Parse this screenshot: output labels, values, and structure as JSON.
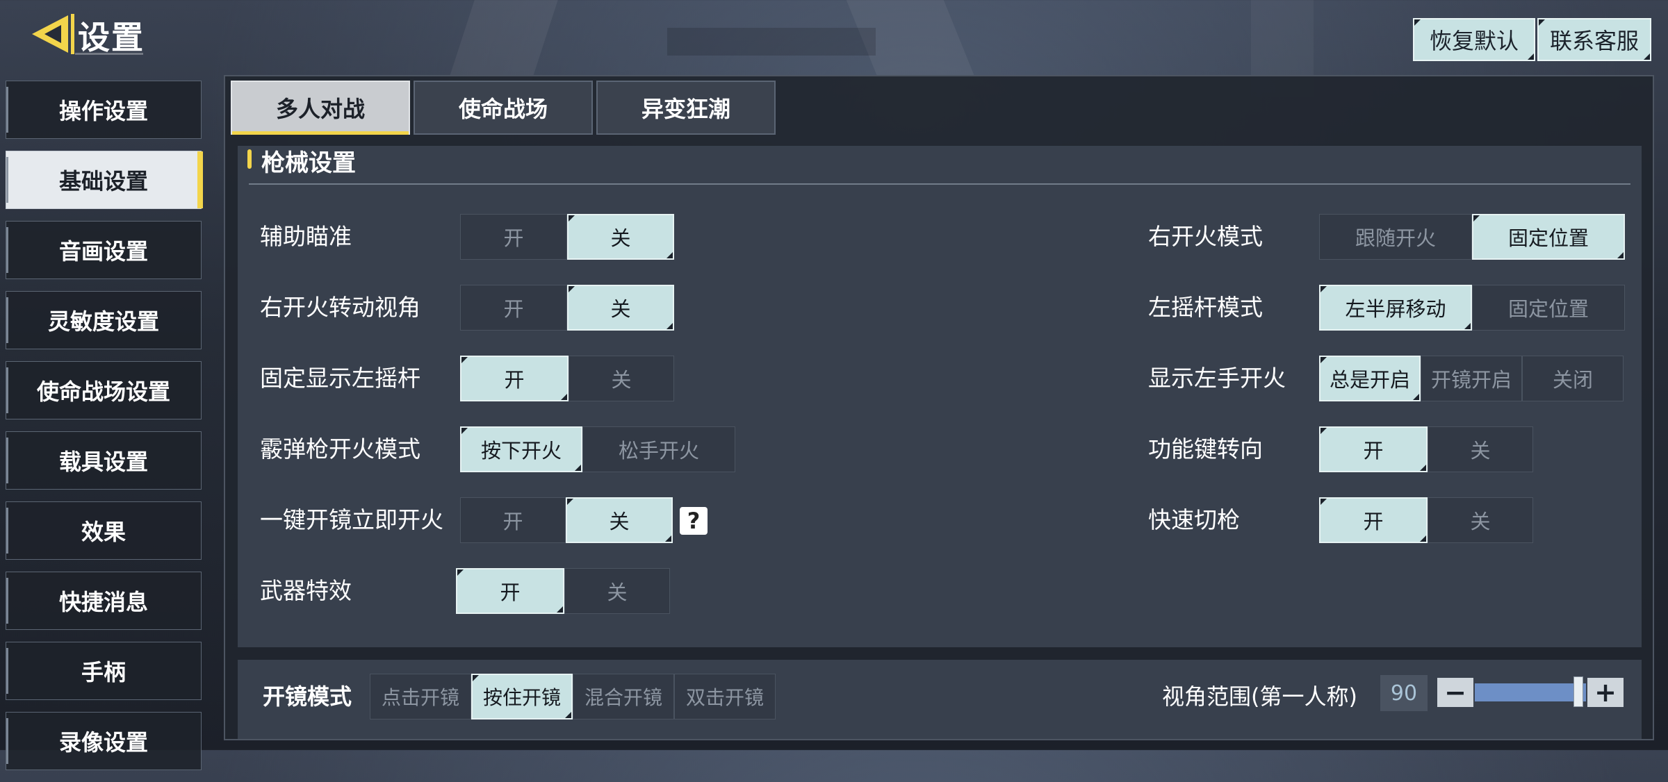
{
  "header": {
    "title": "设置",
    "restore_default": "恢复默认",
    "contact_support": "联系客服"
  },
  "sidebar": {
    "items": [
      {
        "label": "操作设置"
      },
      {
        "label": "基础设置",
        "active": true
      },
      {
        "label": "音画设置"
      },
      {
        "label": "灵敏度设置"
      },
      {
        "label": "使命战场设置"
      },
      {
        "label": "载具设置"
      },
      {
        "label": "效果"
      },
      {
        "label": "快捷消息"
      },
      {
        "label": "手柄"
      },
      {
        "label": "录像设置"
      }
    ]
  },
  "tabs": [
    {
      "label": "多人对战",
      "active": true
    },
    {
      "label": "使命战场"
    },
    {
      "label": "异变狂潮"
    }
  ],
  "weapon_settings": {
    "title": "枪械设置",
    "left": [
      {
        "label": "辅助瞄准",
        "options": [
          "开",
          "关"
        ],
        "selected": "关"
      },
      {
        "label": "右开火转动视角",
        "options": [
          "开",
          "关"
        ],
        "selected": "关"
      },
      {
        "label": "固定显示左摇杆",
        "options": [
          "开",
          "关"
        ],
        "selected": "开"
      },
      {
        "label": "霰弹枪开火模式",
        "options": [
          "按下开火",
          "松手开火"
        ],
        "selected": "按下开火"
      },
      {
        "label": "一键开镜立即开火",
        "options": [
          "开",
          "关"
        ],
        "selected": "关",
        "help": "?"
      },
      {
        "label": "武器特效",
        "options": [
          "开",
          "关"
        ],
        "selected": "开"
      }
    ],
    "right": [
      {
        "label": "右开火模式",
        "options": [
          "跟随开火",
          "固定位置"
        ],
        "selected": "固定位置"
      },
      {
        "label": "左摇杆模式",
        "options": [
          "左半屏移动",
          "固定位置"
        ],
        "selected": "左半屏移动"
      },
      {
        "label": "显示左手开火",
        "options": [
          "总是开启",
          "开镜开启",
          "关闭"
        ],
        "selected": "总是开启"
      },
      {
        "label": "功能键转向",
        "options": [
          "开",
          "关"
        ],
        "selected": "开"
      },
      {
        "label": "快速切枪",
        "options": [
          "开",
          "关"
        ],
        "selected": "开"
      }
    ]
  },
  "scope": {
    "label": "开镜模式",
    "options": [
      "点击开镜",
      "按住开镜",
      "混合开镜",
      "双击开镜"
    ],
    "selected": "按住开镜"
  },
  "fov": {
    "label": "视角范围(第一人称)",
    "value": "90",
    "minus": "−",
    "plus": "+"
  },
  "colors": {
    "accent": "#f3d54b",
    "toggle_on": "#c8e2e3",
    "toggle_off": "#323945"
  }
}
